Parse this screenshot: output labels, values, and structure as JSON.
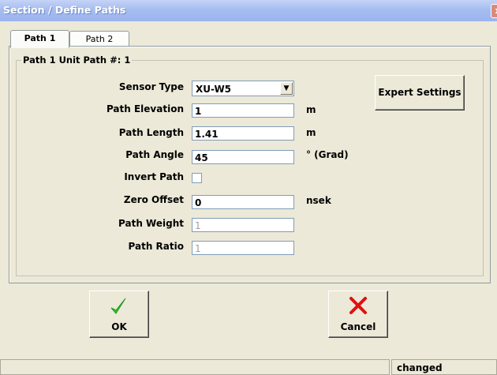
{
  "window": {
    "title": "Section / Define Paths",
    "close_glyph": "x"
  },
  "tabs": [
    {
      "label": "Path 1",
      "active": true
    },
    {
      "label": "Path 2",
      "active": false
    }
  ],
  "group": {
    "label": "Path 1 Unit Path #: 1"
  },
  "fields": {
    "sensor_type": {
      "label": "Sensor Type",
      "value": "XU-W5"
    },
    "path_elevation": {
      "label": "Path Elevation",
      "value": "1",
      "unit": "m"
    },
    "path_length": {
      "label": "Path Length",
      "value": "1.41",
      "unit": "m"
    },
    "path_angle": {
      "label": "Path Angle",
      "value": "45",
      "unit": "° (Grad)"
    },
    "invert_path": {
      "label": "Invert Path",
      "checked": false
    },
    "zero_offset": {
      "label": "Zero Offset",
      "value": "0",
      "unit": "nsek"
    },
    "path_weight": {
      "label": "Path Weight",
      "value": "1"
    },
    "path_ratio": {
      "label": "Path Ratio",
      "value": "1"
    }
  },
  "buttons": {
    "expert_settings": "Expert Settings",
    "ok": "OK",
    "cancel": "Cancel"
  },
  "statusbar": {
    "status_text": "changed"
  },
  "colors": {
    "ok_check": "#2fc62f",
    "cancel_x": "#e01010"
  }
}
